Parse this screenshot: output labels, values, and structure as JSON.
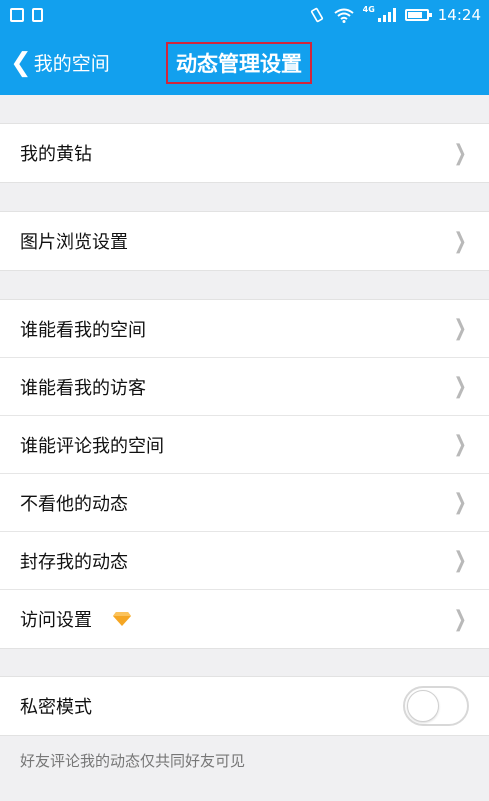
{
  "status_bar": {
    "time": "14:24",
    "network": "4G"
  },
  "nav": {
    "back_label": "我的空间",
    "title": "动态管理设置"
  },
  "groups": [
    {
      "items": [
        {
          "label": "我的黄钻"
        }
      ]
    },
    {
      "items": [
        {
          "label": "图片浏览设置"
        }
      ]
    },
    {
      "items": [
        {
          "label": "谁能看我的空间"
        },
        {
          "label": "谁能看我的访客"
        },
        {
          "label": "谁能评论我的空间"
        },
        {
          "label": "不看他的动态"
        },
        {
          "label": "封存我的动态"
        },
        {
          "label": "访问设置",
          "icon": "diamond-icon"
        }
      ]
    }
  ],
  "private_mode": {
    "label": "私密模式",
    "enabled": false
  },
  "hint": "好友评论我的动态仅共同好友可见",
  "colors": {
    "accent": "#12a0ee",
    "title_outline": "#d2263b",
    "diamond": "#f5a623"
  }
}
